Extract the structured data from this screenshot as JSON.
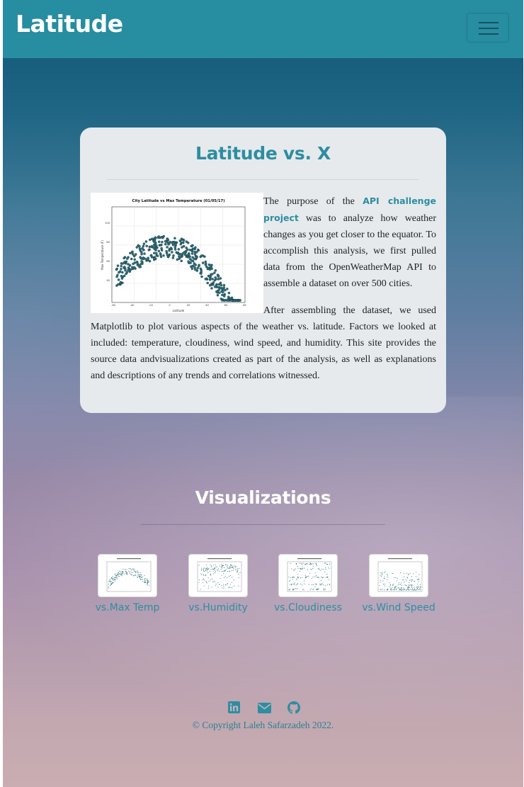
{
  "navbar": {
    "brand": "Latitude",
    "toggle_icon": "hamburger-icon",
    "bg_color": "#278da1"
  },
  "intro": {
    "title": "Latitude vs. X",
    "thumbnail_title": "City Latitude vs Max Temperature (01/05/17)",
    "thumbnail_xlabel": "Latitude",
    "thumbnail_ylabel": "Max Temperature (F)",
    "p1_before_link": "The purpose of the ",
    "link_text": "API challenge project",
    "p1_after_link": " was to analyze how weather changes as you get closer to the equator. To accomplish this analysis, we first pulled data from the OpenWeatherMap API to assemble a dataset on over 500 cities.",
    "p2": "After assembling the dataset, we used Matplotlib to plot various aspects of the weather vs. latitude. Factors we looked at included: temperature, cloudiness, wind speed, and humidity. This site provides the source data andvisualizations created as part of the analysis, as well as explanations and descriptions of any trends and correlations witnessed."
  },
  "visualizations": {
    "title": "Visualizations",
    "items": [
      {
        "label": "vs.Max Temp"
      },
      {
        "label": "vs.Humidity"
      },
      {
        "label": "vs.Cloudiness"
      },
      {
        "label": "vs.Wind Speed"
      }
    ]
  },
  "footer": {
    "icons": [
      "linkedin-icon",
      "envelope-icon",
      "github-icon"
    ],
    "copyright": "© Copyright Laleh Safarzadeh 2022."
  },
  "colors": {
    "accent": "#2e8da1",
    "card_bg": "#e6eaed",
    "point_color": "#2c6f78"
  }
}
